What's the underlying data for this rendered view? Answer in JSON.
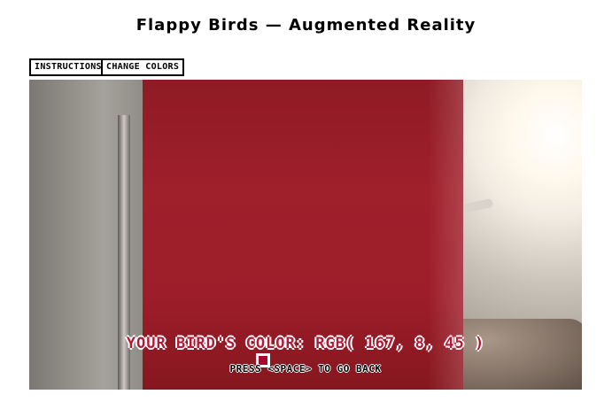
{
  "page": {
    "title": "Flappy Birds — Augmented Reality"
  },
  "toolbar": {
    "instructions_label": "Instructions",
    "change_colors_label": "Change Colors"
  },
  "game": {
    "bird_color_text": "Your Bird's Color: RGB( 167, 8, 45 )",
    "back_hint": "Press <Space> to go back",
    "bird_color_rgb": [
      167,
      8,
      45
    ],
    "bird_color_hex": "#a7082d"
  }
}
